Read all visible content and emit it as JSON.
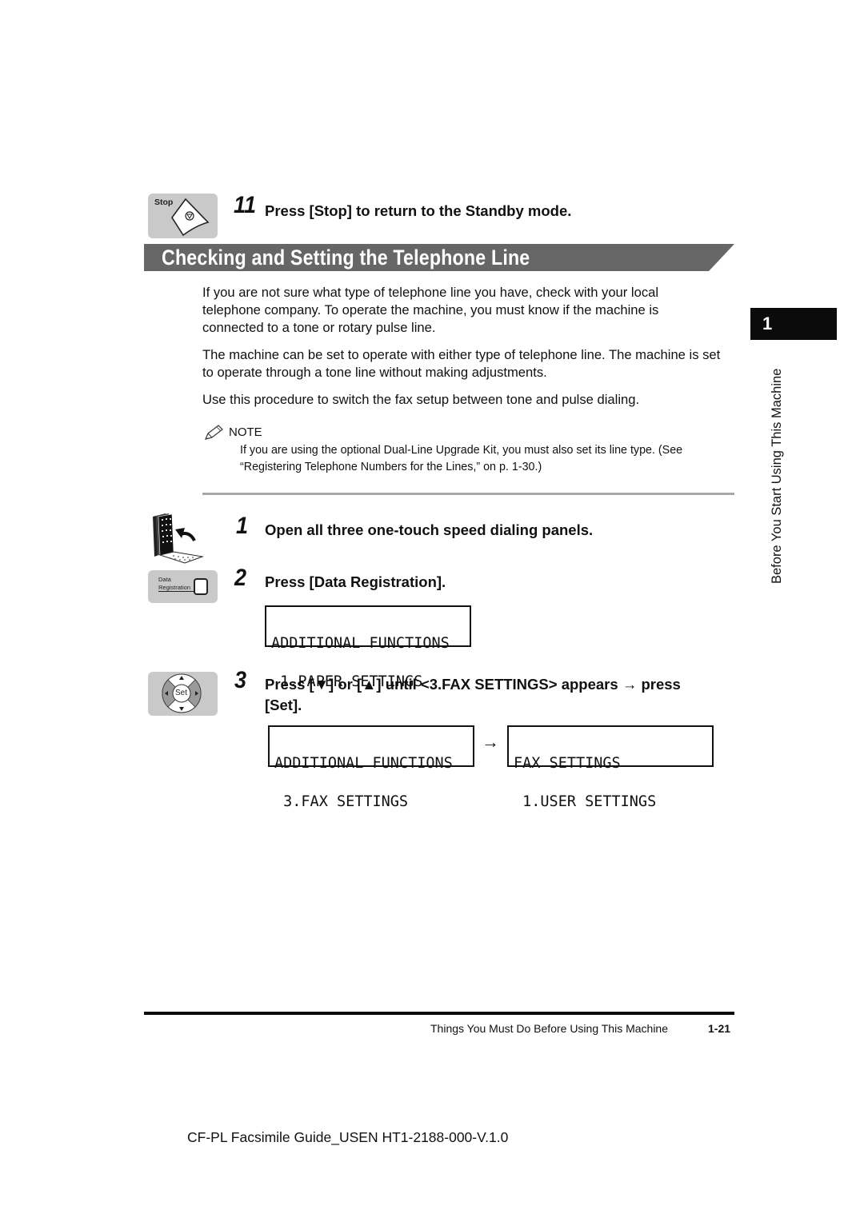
{
  "step11": {
    "icon_label": "Stop",
    "number": "11",
    "text": "Press [Stop] to return to the Standby mode."
  },
  "section": {
    "title": "Checking and Setting the Telephone Line",
    "bar_color": "#666666"
  },
  "intro": {
    "paragraphs": [
      "If you are not sure what type of telephone line you have, check with your local telephone company. To operate the machine, you must know if the machine is connected to a tone or rotary pulse line.",
      "The machine can be set to operate with either type of telephone line. The machine is set to operate through a tone line without making adjustments.",
      "Use this procedure to switch the fax setup between tone and pulse dialing."
    ]
  },
  "note": {
    "label": "NOTE",
    "text": "If you are using the optional Dual-Line Upgrade Kit, you must also set its line type. (See “Registering Telephone Numbers for the Lines,” on p. 1-30.)"
  },
  "steps": [
    {
      "number": "1",
      "text": "Open all three one-touch speed dialing panels."
    },
    {
      "number": "2",
      "icon_label_line1": "Data",
      "icon_label_line2": "Registration",
      "text": "Press [Data Registration].",
      "lcd": {
        "line1": "ADDITIONAL FUNCTIONS",
        "line2": " 1.PAPER SETTINGS"
      }
    },
    {
      "number": "3",
      "icon_label": "Set",
      "text_line1": "Press [▼] or [▲] until <3.FAX SETTINGS> appears → press",
      "text_line2": "[Set].",
      "lcd_before": {
        "line1": "ADDITIONAL FUNCTIONS",
        "line2": " 3.FAX SETTINGS"
      },
      "arrow": "→",
      "lcd_after": {
        "line1": "FAX SETTINGS",
        "line2": " 1.USER SETTINGS"
      }
    }
  ],
  "side_tab": {
    "chapter": "1",
    "label": "Before You Start Using This Machine"
  },
  "footer": {
    "chapter_title": "Things You Must Do Before Using This Machine",
    "page": "1-21"
  },
  "doc_id": "CF-PL Facsimile Guide_USEN HT1-2188-000-V.1.0"
}
